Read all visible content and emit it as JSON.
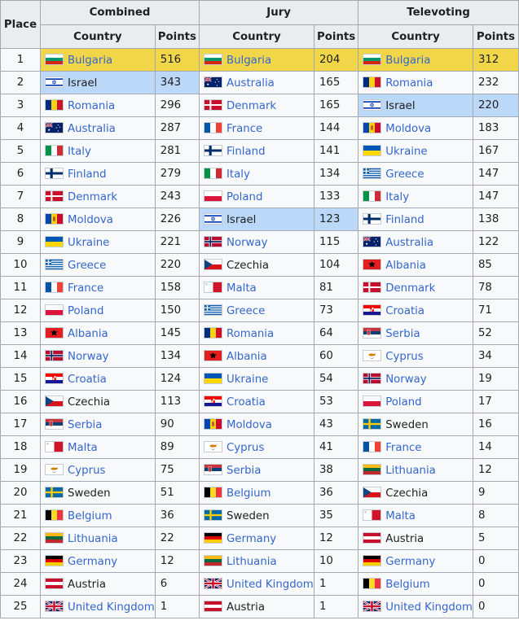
{
  "headers": {
    "place": "Place",
    "groups": [
      "Combined",
      "Jury",
      "Televoting"
    ],
    "country": "Country",
    "points": "Points"
  },
  "highlight_colors": {
    "gold": "#f2d64a",
    "blue": "#bcd8f8"
  },
  "rows": [
    {
      "place": "1",
      "combined": {
        "country": "Bulgaria",
        "points": "516",
        "hl": "gold",
        "link": true
      },
      "jury": {
        "country": "Bulgaria",
        "points": "204",
        "hl": "gold",
        "link": true
      },
      "televoting": {
        "country": "Bulgaria",
        "points": "312",
        "hl": "gold",
        "link": true
      }
    },
    {
      "place": "2",
      "combined": {
        "country": "Israel",
        "points": "343",
        "hl": "blue",
        "link": false
      },
      "jury": {
        "country": "Australia",
        "points": "165",
        "link": true
      },
      "televoting": {
        "country": "Romania",
        "points": "232",
        "link": true
      }
    },
    {
      "place": "3",
      "combined": {
        "country": "Romania",
        "points": "296",
        "link": true
      },
      "jury": {
        "country": "Denmark",
        "points": "165",
        "link": true
      },
      "televoting": {
        "country": "Israel",
        "points": "220",
        "hl": "blue",
        "link": false
      }
    },
    {
      "place": "4",
      "combined": {
        "country": "Australia",
        "points": "287",
        "link": true
      },
      "jury": {
        "country": "France",
        "points": "144",
        "link": true
      },
      "televoting": {
        "country": "Moldova",
        "points": "183",
        "link": true
      }
    },
    {
      "place": "5",
      "combined": {
        "country": "Italy",
        "points": "281",
        "link": true
      },
      "jury": {
        "country": "Finland",
        "points": "141",
        "link": true
      },
      "televoting": {
        "country": "Ukraine",
        "points": "167",
        "link": true
      }
    },
    {
      "place": "6",
      "combined": {
        "country": "Finland",
        "points": "279",
        "link": true
      },
      "jury": {
        "country": "Italy",
        "points": "134",
        "link": true
      },
      "televoting": {
        "country": "Greece",
        "points": "147",
        "link": true
      }
    },
    {
      "place": "7",
      "combined": {
        "country": "Denmark",
        "points": "243",
        "link": true
      },
      "jury": {
        "country": "Poland",
        "points": "133",
        "link": true
      },
      "televoting": {
        "country": "Italy",
        "points": "147",
        "link": true
      }
    },
    {
      "place": "8",
      "combined": {
        "country": "Moldova",
        "points": "226",
        "link": true
      },
      "jury": {
        "country": "Israel",
        "points": "123",
        "hl": "blue",
        "link": false
      },
      "televoting": {
        "country": "Finland",
        "points": "138",
        "link": true
      }
    },
    {
      "place": "9",
      "combined": {
        "country": "Ukraine",
        "points": "221",
        "link": true
      },
      "jury": {
        "country": "Norway",
        "points": "115",
        "link": true
      },
      "televoting": {
        "country": "Australia",
        "points": "122",
        "link": true
      }
    },
    {
      "place": "10",
      "combined": {
        "country": "Greece",
        "points": "220",
        "link": true
      },
      "jury": {
        "country": "Czechia",
        "points": "104",
        "link": false
      },
      "televoting": {
        "country": "Albania",
        "points": "85",
        "link": true
      }
    },
    {
      "place": "11",
      "combined": {
        "country": "France",
        "points": "158",
        "link": true
      },
      "jury": {
        "country": "Malta",
        "points": "81",
        "link": true
      },
      "televoting": {
        "country": "Denmark",
        "points": "78",
        "link": true
      }
    },
    {
      "place": "12",
      "combined": {
        "country": "Poland",
        "points": "150",
        "link": true
      },
      "jury": {
        "country": "Greece",
        "points": "73",
        "link": true
      },
      "televoting": {
        "country": "Croatia",
        "points": "71",
        "link": true
      }
    },
    {
      "place": "13",
      "combined": {
        "country": "Albania",
        "points": "145",
        "link": true
      },
      "jury": {
        "country": "Romania",
        "points": "64",
        "link": true
      },
      "televoting": {
        "country": "Serbia",
        "points": "52",
        "link": true
      }
    },
    {
      "place": "14",
      "combined": {
        "country": "Norway",
        "points": "134",
        "link": true
      },
      "jury": {
        "country": "Albania",
        "points": "60",
        "link": true
      },
      "televoting": {
        "country": "Cyprus",
        "points": "34",
        "link": true
      }
    },
    {
      "place": "15",
      "combined": {
        "country": "Croatia",
        "points": "124",
        "link": true
      },
      "jury": {
        "country": "Ukraine",
        "points": "54",
        "link": true
      },
      "televoting": {
        "country": "Norway",
        "points": "19",
        "link": true
      }
    },
    {
      "place": "16",
      "combined": {
        "country": "Czechia",
        "points": "113",
        "link": false
      },
      "jury": {
        "country": "Croatia",
        "points": "53",
        "link": true
      },
      "televoting": {
        "country": "Poland",
        "points": "17",
        "link": true
      }
    },
    {
      "place": "17",
      "combined": {
        "country": "Serbia",
        "points": "90",
        "link": true
      },
      "jury": {
        "country": "Moldova",
        "points": "43",
        "link": true
      },
      "televoting": {
        "country": "Sweden",
        "points": "16",
        "link": false
      }
    },
    {
      "place": "18",
      "combined": {
        "country": "Malta",
        "points": "89",
        "link": true
      },
      "jury": {
        "country": "Cyprus",
        "points": "41",
        "link": true
      },
      "televoting": {
        "country": "France",
        "points": "14",
        "link": true
      }
    },
    {
      "place": "19",
      "combined": {
        "country": "Cyprus",
        "points": "75",
        "link": true
      },
      "jury": {
        "country": "Serbia",
        "points": "38",
        "link": true
      },
      "televoting": {
        "country": "Lithuania",
        "points": "12",
        "link": true
      }
    },
    {
      "place": "20",
      "combined": {
        "country": "Sweden",
        "points": "51",
        "link": false
      },
      "jury": {
        "country": "Belgium",
        "points": "36",
        "link": true
      },
      "televoting": {
        "country": "Czechia",
        "points": "9",
        "link": false
      }
    },
    {
      "place": "21",
      "combined": {
        "country": "Belgium",
        "points": "36",
        "link": true
      },
      "jury": {
        "country": "Sweden",
        "points": "35",
        "link": false
      },
      "televoting": {
        "country": "Malta",
        "points": "8",
        "link": true
      }
    },
    {
      "place": "22",
      "combined": {
        "country": "Lithuania",
        "points": "22",
        "link": true
      },
      "jury": {
        "country": "Germany",
        "points": "12",
        "link": true
      },
      "televoting": {
        "country": "Austria",
        "points": "5",
        "link": false
      }
    },
    {
      "place": "23",
      "combined": {
        "country": "Germany",
        "points": "12",
        "link": true
      },
      "jury": {
        "country": "Lithuania",
        "points": "10",
        "link": true
      },
      "televoting": {
        "country": "Germany",
        "points": "0",
        "link": true
      }
    },
    {
      "place": "24",
      "combined": {
        "country": "Austria",
        "points": "6",
        "link": false
      },
      "jury": {
        "country": "United Kingdom",
        "points": "1",
        "link": true
      },
      "televoting": {
        "country": "Belgium",
        "points": "0",
        "link": true
      }
    },
    {
      "place": "25",
      "combined": {
        "country": "United Kingdom",
        "points": "1",
        "link": true
      },
      "jury": {
        "country": "Austria",
        "points": "1",
        "link": false
      },
      "televoting": {
        "country": "United Kingdom",
        "points": "0",
        "link": true
      }
    }
  ]
}
